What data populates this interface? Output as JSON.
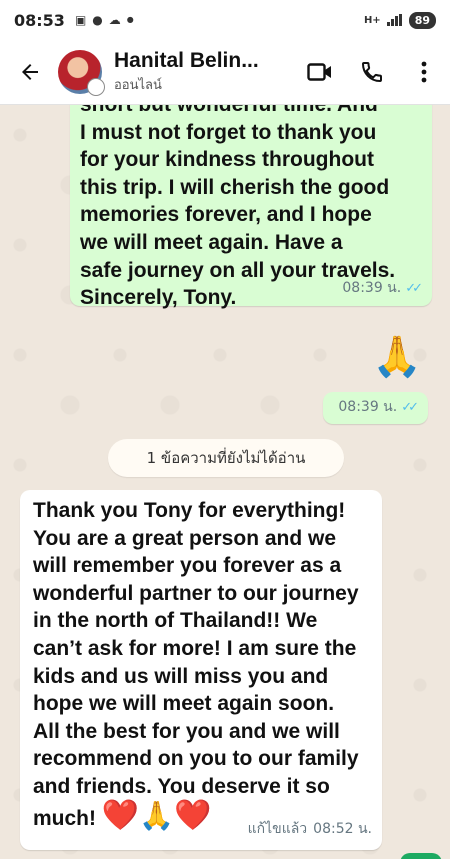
{
  "status_bar": {
    "time": "08:53",
    "network": "H+",
    "battery": "89"
  },
  "header": {
    "contact_name": "Hanital Belin...",
    "contact_status": "ออนไลน์"
  },
  "messages": [
    {
      "direction": "outgoing",
      "text": "short but wonderful time. And\nI must not forget to thank you\nfor your kindness throughout\nthis trip. I will cherish the good\nmemories forever, and I hope\nwe will meet again. Have a\nsafe journey on all your travels.\nSincerely, Tony.",
      "time": "08:39 น.",
      "read": true
    },
    {
      "direction": "outgoing",
      "emoji": "🙏",
      "time": "08:39 น.",
      "read": true
    },
    {
      "direction": "incoming",
      "text": "Thank you Tony for everything!\nYou are a great person and we\nwill remember you forever as a\nwonderful partner to our journey\nin the north of Thailand!! We\ncan’t ask for more! I am sure the\nkids and us will miss you and\nhope we will meet again soon.\nAll the best for you and we will\nrecommend on you to our family\nand friends. You deserve it so\nmuch!",
      "emojis": [
        "❤️",
        "🙏",
        "❤️"
      ],
      "edited_label": "แก้ไขแล้ว",
      "time": "08:52 น."
    }
  ],
  "unread_banner": "1 ข้อความที่ยังไม่ได้อ่าน",
  "colors": {
    "outgoing_bubble": "#d9fdd3",
    "incoming_bubble": "#ffffff",
    "read_ticks": "#53bdeb",
    "chat_background": "#efe7dd"
  }
}
